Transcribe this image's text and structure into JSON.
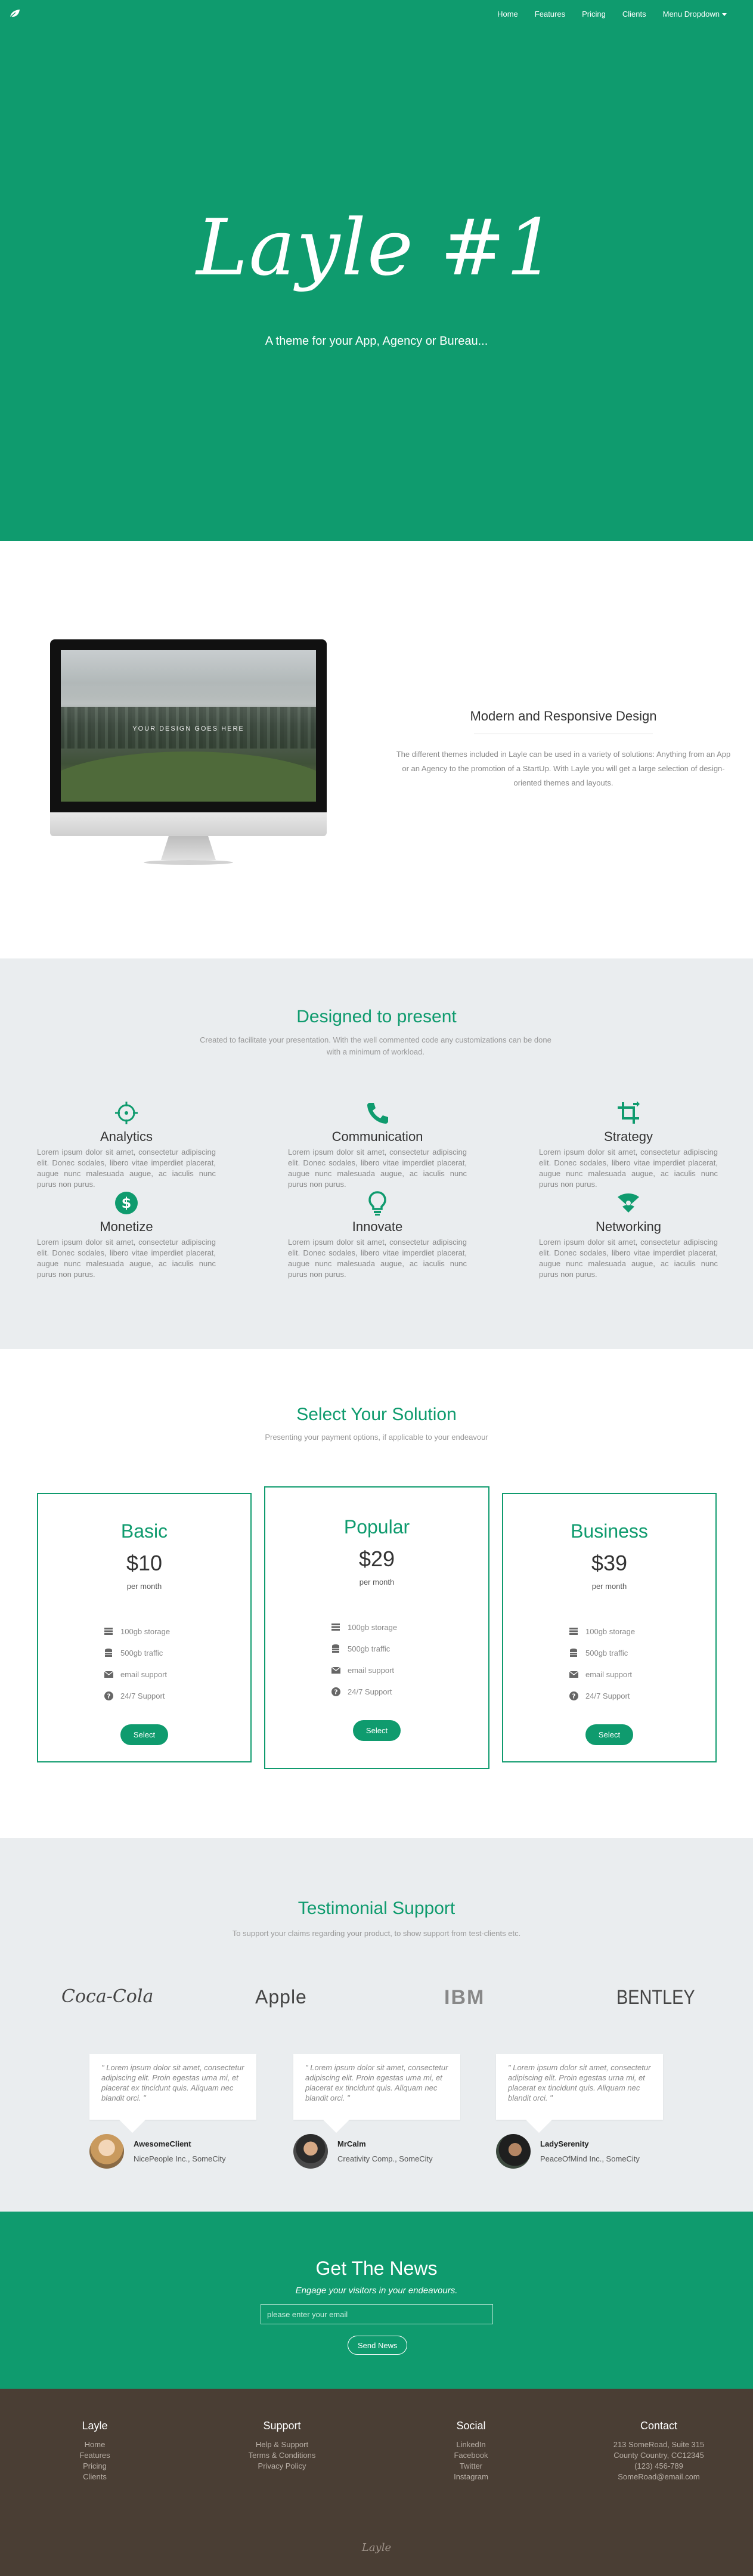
{
  "nav": {
    "items": [
      "Home",
      "Features",
      "Pricing",
      "Clients",
      "Menu Dropdown"
    ]
  },
  "hero": {
    "title": "Layle #1",
    "subtitle": "A theme for your App, Agency or Bureau..."
  },
  "feature": {
    "screen_text": "YOUR DESIGN GOES HERE",
    "title": "Modern and Responsive Design",
    "text": "The different themes included in Layle can be used in a variety of solutions: Anything from an App or an Agency to the promotion of a StartUp. With Layle you will get a large selection of design-oriented themes and layouts."
  },
  "services": {
    "title": "Designed to present",
    "subtitle": "Created to facilitate your presentation. With the well commented code any customizations can be done with a minimum of workload.",
    "items": [
      {
        "title": "Analytics",
        "icon": "crosshair-icon",
        "text": "Lorem ipsum dolor sit amet, consectetur adipiscing elit. Donec sodales, libero vitae imperdiet placerat, augue nunc malesuada augue, ac iaculis nunc purus non purus."
      },
      {
        "title": "Communication",
        "icon": "phone-icon",
        "text": "Lorem ipsum dolor sit amet, consectetur adipiscing elit. Donec sodales, libero vitae imperdiet placerat, augue nunc malesuada augue, ac iaculis nunc purus non purus."
      },
      {
        "title": "Strategy",
        "icon": "crop-icon",
        "text": "Lorem ipsum dolor sit amet, consectetur adipiscing elit. Donec sodales, libero vitae imperdiet placerat, augue nunc malesuada augue, ac iaculis nunc purus non purus."
      },
      {
        "title": "Monetize",
        "icon": "dollar-icon",
        "text": "Lorem ipsum dolor sit amet, consectetur adipiscing elit. Donec sodales, libero vitae imperdiet placerat, augue nunc malesuada augue, ac iaculis nunc purus non purus."
      },
      {
        "title": "Innovate",
        "icon": "lightbulb-icon",
        "text": "Lorem ipsum dolor sit amet, consectetur adipiscing elit. Donec sodales, libero vitae imperdiet placerat, augue nunc malesuada augue, ac iaculis nunc purus non purus."
      },
      {
        "title": "Networking",
        "icon": "network-icon",
        "text": "Lorem ipsum dolor sit amet, consectetur adipiscing elit. Donec sodales, libero vitae imperdiet placerat, augue nunc malesuada augue, ac iaculis nunc purus non purus."
      }
    ]
  },
  "pricing": {
    "title": "Select Your Solution",
    "subtitle": "Presenting your payment options, if applicable to your endeavour",
    "plans": [
      {
        "name": "Basic",
        "price": "$10",
        "period": "per month",
        "features": [
          "100gb storage",
          "500gb traffic",
          "email support",
          "24/7 Support"
        ],
        "button": "Select"
      },
      {
        "name": "Popular",
        "price": "$29",
        "period": "per month",
        "features": [
          "100gb storage",
          "500gb traffic",
          "email support",
          "24/7 Support"
        ],
        "button": "Select"
      },
      {
        "name": "Business",
        "price": "$39",
        "period": "per month",
        "features": [
          "100gb storage",
          "500gb traffic",
          "email support",
          "24/7 Support"
        ],
        "button": "Select"
      }
    ]
  },
  "testimonials": {
    "title": "Testimonial Support",
    "subtitle": "To support your claims regarding your product, to show support from test-clients etc.",
    "brands": [
      "Coca-Cola",
      "Apple",
      "IBM",
      "BENTLEY"
    ],
    "quotes": [
      {
        "text": "\" Lorem ipsum dolor sit amet, consectetur adipiscing elit. Proin egestas urna mi, et placerat ex tincidunt quis. Aliquam nec blandit orci. \"",
        "name": "AwesomeClient",
        "company": "NicePeople Inc., SomeCity"
      },
      {
        "text": "\" Lorem ipsum dolor sit amet, consectetur adipiscing elit. Proin egestas urna mi, et placerat ex tincidunt quis. Aliquam nec blandit orci. \"",
        "name": "MrCalm",
        "company": "Creativity Comp., SomeCity"
      },
      {
        "text": "\" Lorem ipsum dolor sit amet, consectetur adipiscing elit. Proin egestas urna mi, et placerat ex tincidunt quis. Aliquam nec blandit orci. \"",
        "name": "LadySerenity",
        "company": "PeaceOfMind Inc., SomeCity"
      }
    ]
  },
  "newsletter": {
    "title": "Get The News",
    "tagline": "Engage your visitors in your endeavours.",
    "placeholder": "please enter your email",
    "button": "Send News"
  },
  "footer": {
    "columns": [
      {
        "title": "Layle",
        "links": [
          "Home",
          "Features",
          "Pricing",
          "Clients"
        ]
      },
      {
        "title": "Support",
        "links": [
          "Help & Support",
          "Terms & Conditions",
          "Privacy Policy"
        ]
      },
      {
        "title": "Social",
        "links": [
          "LinkedIn",
          "Facebook",
          "Twitter",
          "Instagram"
        ]
      },
      {
        "title": "Contact",
        "lines": [
          "213 SomeRoad, Suite 315",
          "County Country, CC12345",
          "(123) 456-789",
          "SomeRoad@email.com"
        ]
      }
    ],
    "logo": "Layle"
  },
  "colors": {
    "brand_green": "#0f9b6e",
    "light_gray": "#eaedef",
    "footer_brown": "#4a3e34"
  }
}
